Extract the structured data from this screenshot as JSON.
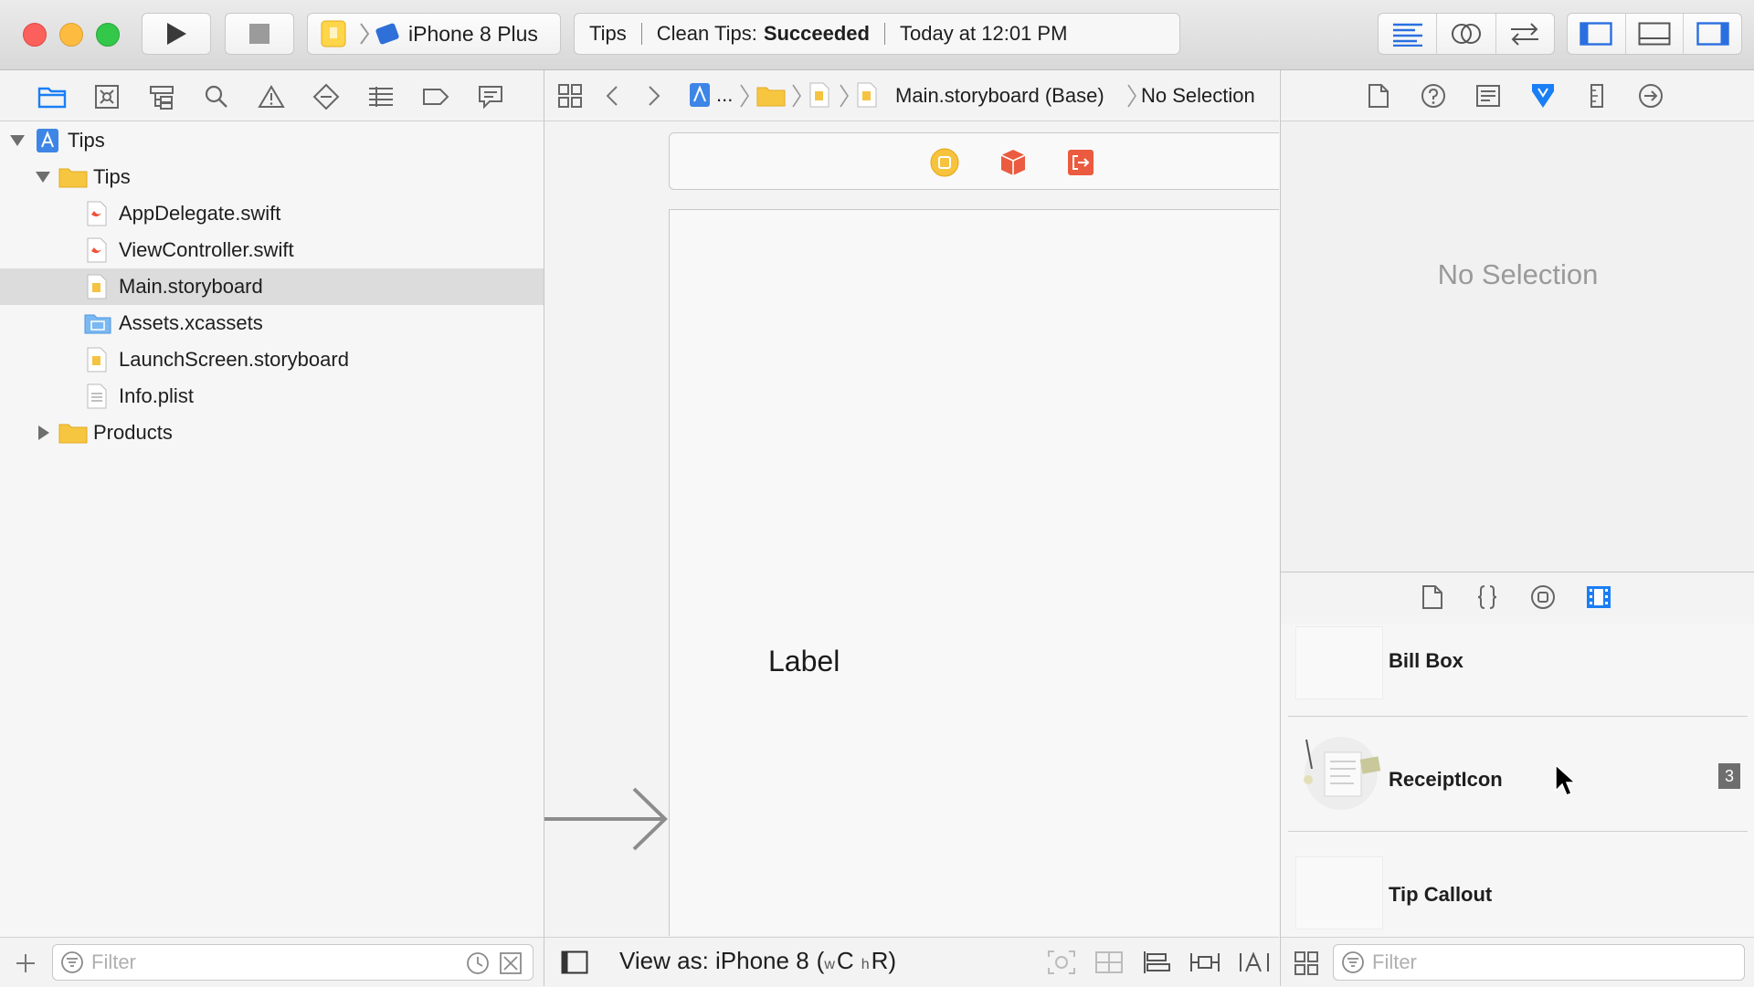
{
  "toolbar": {
    "scheme_target": "iPhone 8 Plus",
    "status": {
      "project": "Tips",
      "action": "Clean Tips:",
      "result": "Succeeded",
      "time": "Today at 12:01 PM"
    }
  },
  "navigator": {
    "tree": [
      {
        "label": "Tips",
        "kind": "project"
      },
      {
        "label": "Tips",
        "kind": "group"
      },
      {
        "label": "AppDelegate.swift",
        "kind": "swift"
      },
      {
        "label": "ViewController.swift",
        "kind": "swift"
      },
      {
        "label": "Main.storyboard",
        "kind": "storyboard",
        "selected": true
      },
      {
        "label": "Assets.xcassets",
        "kind": "assets"
      },
      {
        "label": "LaunchScreen.storyboard",
        "kind": "storyboard"
      },
      {
        "label": "Info.plist",
        "kind": "plist"
      },
      {
        "label": "Products",
        "kind": "group"
      }
    ],
    "filter_placeholder": "Filter"
  },
  "editor": {
    "jumpbar": {
      "ellipsis": "...",
      "file": "Main.storyboard (Base)",
      "selection": "No Selection"
    },
    "canvas": {
      "label_text": "Label"
    },
    "bottom": {
      "view_as": "View as: iPhone 8",
      "size_class_w": "w",
      "size_class_c": "C",
      "size_class_h": "h",
      "size_class_r": "R"
    }
  },
  "inspector": {
    "empty_text": "No Selection"
  },
  "library": {
    "items": [
      {
        "title": "Bill Box"
      },
      {
        "title": "ReceiptIcon",
        "badge": "3"
      },
      {
        "title": "Tip Callout"
      }
    ],
    "filter_placeholder": "Filter"
  },
  "colors": {
    "accent": "#1a7ef5",
    "close": "#fc605c",
    "minimize": "#fdbc40",
    "zoom": "#34c84a",
    "selection": "#dcdcdc"
  }
}
